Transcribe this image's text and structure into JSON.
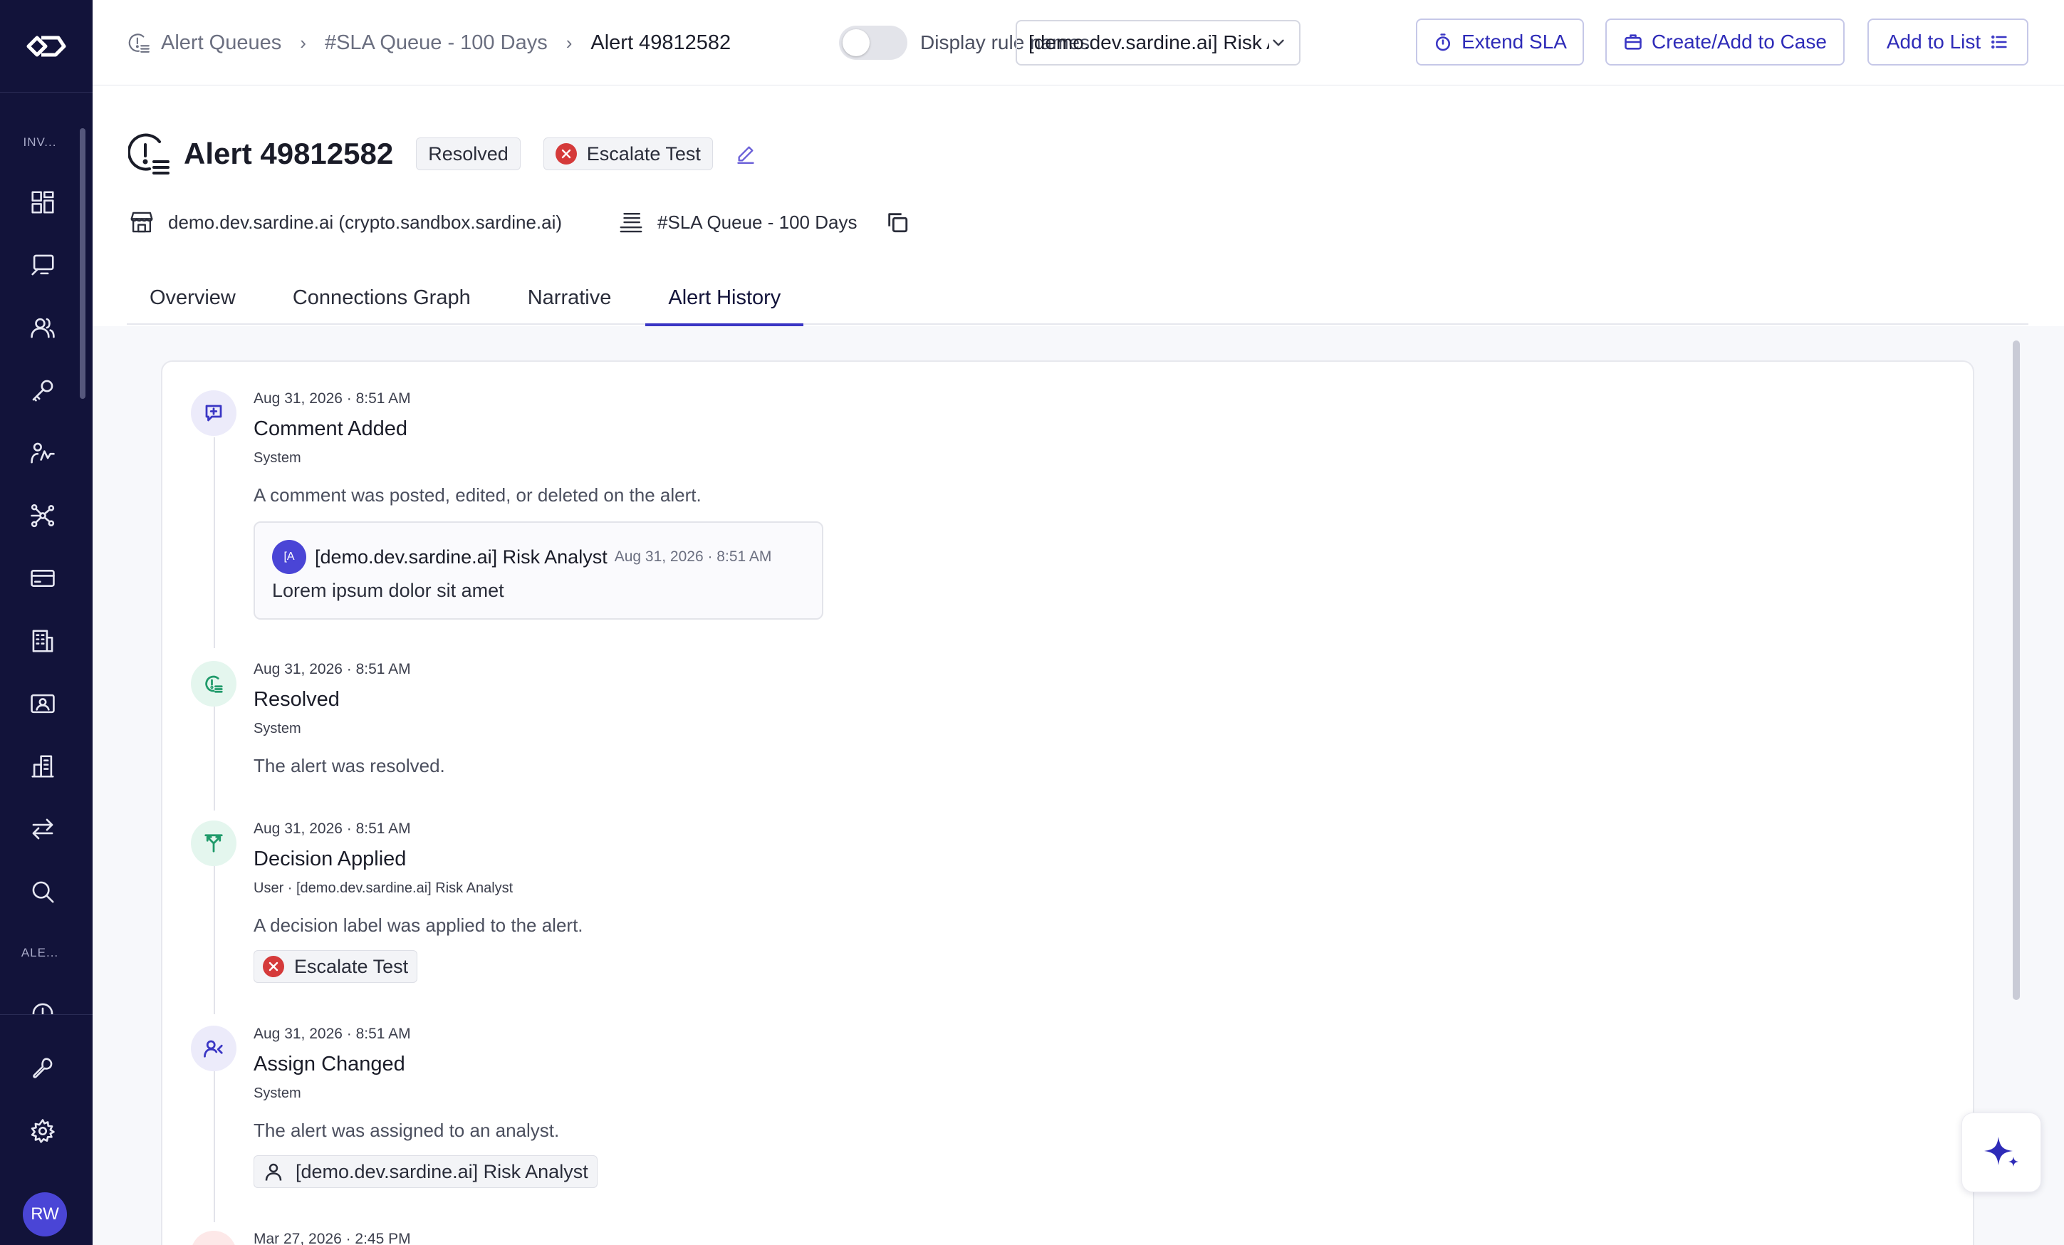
{
  "sidebar": {
    "section_invest": "INV...",
    "section_alerts": "ALE...",
    "avatar_initials": "RW",
    "nav_icons": [
      "dashboard-icon",
      "monitor-icon",
      "users-icon",
      "key-icon",
      "analytics-icon",
      "network-icon",
      "credit-card-icon",
      "building-icon",
      "id-card-icon",
      "buildings-icon",
      "transfer-icon",
      "search-icon",
      "alert-queue-icon",
      "wrench-icon",
      "gear-icon"
    ]
  },
  "header": {
    "breadcrumb": [
      "Alert Queues",
      "#SLA Queue - 100 Days",
      "Alert 49812582"
    ],
    "toggle_label": "Display rule names",
    "toggle_on": false,
    "select_value": "[demo.dev.sardine.ai] Risk Analyst",
    "extend_sla": "Extend SLA",
    "create_case": "Create/Add to Case",
    "add_to_list": "Add to List"
  },
  "alert": {
    "title": "Alert 49812582",
    "status": "Resolved",
    "decision": "Escalate Test",
    "merchant": "demo.dev.sardine.ai (crypto.sandbox.sardine.ai)",
    "queue": "#SLA Queue - 100 Days"
  },
  "tabs": [
    "Overview",
    "Connections Graph",
    "Narrative",
    "Alert History"
  ],
  "active_tab": "Alert History",
  "history": {
    "comment": {
      "time": "Aug 31, 2026 · 8:51 AM",
      "title": "Comment Added",
      "by": "System",
      "desc": "A comment was posted, edited, or deleted on the alert.",
      "author_initials": "[A",
      "author": "[demo.dev.sardine.ai] Risk Analyst",
      "comment_time": "Aug 31, 2026 · 8:51 AM",
      "text": "Lorem ipsum dolor sit amet"
    },
    "resolved": {
      "time": "Aug 31, 2026 · 8:51 AM",
      "title": "Resolved",
      "by": "System",
      "desc": "The alert was resolved."
    },
    "decision": {
      "time": "Aug 31, 2026 · 8:51 AM",
      "title": "Decision Applied",
      "by": "User · [demo.dev.sardine.ai] Risk Analyst",
      "desc": "A decision label was applied to the alert.",
      "chip": "Escalate Test"
    },
    "assign": {
      "time": "Aug 31, 2026 · 8:51 AM",
      "title": "Assign Changed",
      "by": "System",
      "desc": "The alert was assigned to an analyst.",
      "chip": "[demo.dev.sardine.ai] Risk Analyst"
    },
    "next_time": "Mar 27, 2026 · 2:45 PM"
  },
  "colors": {
    "sidebar_bg": "#12133a",
    "accent": "#3a36c4",
    "danger": "#d53a3a",
    "success": "#1f9a6a"
  }
}
